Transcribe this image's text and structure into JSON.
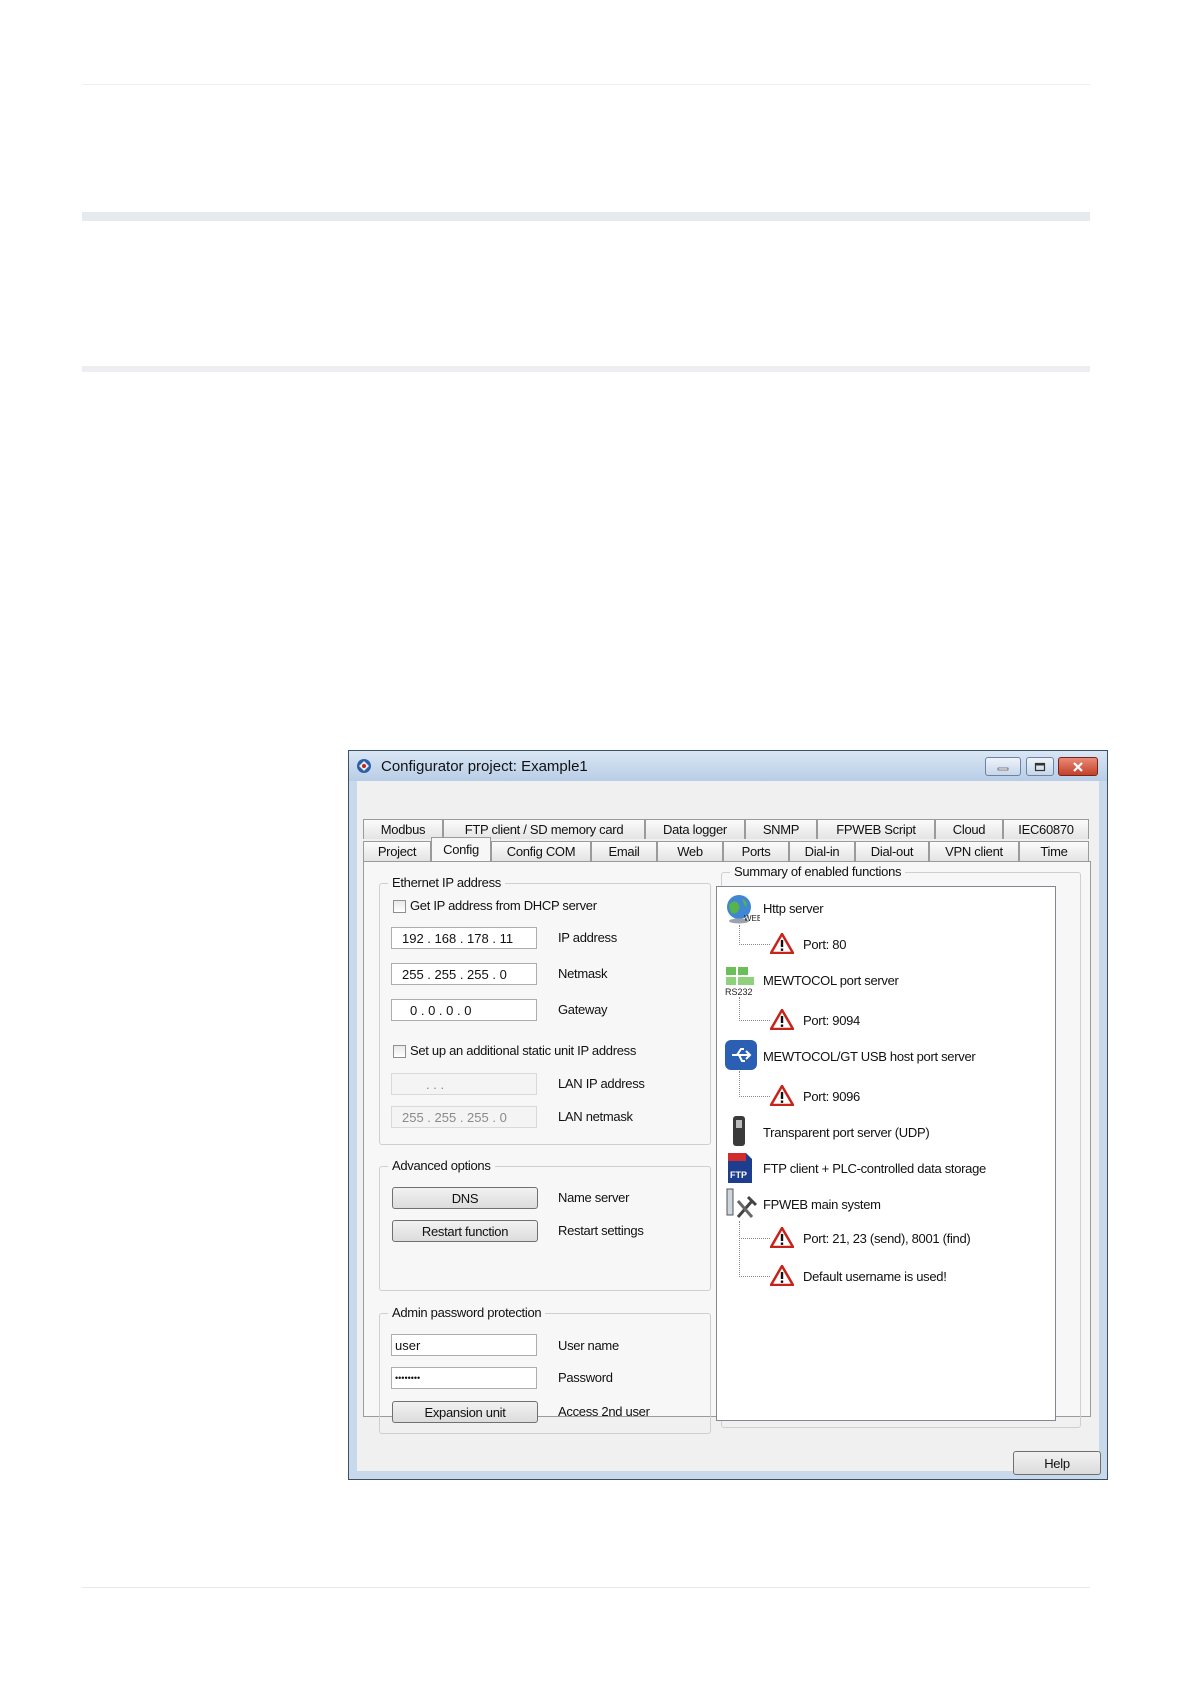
{
  "window": {
    "title": "Configurator project: Example1",
    "tabs_row1": [
      "Modbus",
      "FTP client / SD memory card",
      "Data logger",
      "SNMP",
      "FPWEB Script",
      "Cloud",
      "IEC60870"
    ],
    "tabs_row2": [
      "Project",
      "Config",
      "Config COM",
      "Email",
      "Web",
      "Ports",
      "Dial-in",
      "Dial-out",
      "VPN client",
      "Time"
    ],
    "active_tab": "Config"
  },
  "ethernet": {
    "title": "Ethernet IP address",
    "dhcp_label": "Get IP address from DHCP server",
    "dhcp_checked": false,
    "ip_value": "192 . 168 . 178 .  11",
    "ip_label": "IP address",
    "netmask_value": "255 . 255 . 255 .   0",
    "netmask_label": "Netmask",
    "gateway_value": "0   .   0   .   0   .   0",
    "gateway_label": "Gateway",
    "static_label": "Set up an additional static unit IP address",
    "static_checked": false,
    "lan_ip_value": ".      .      .",
    "lan_ip_label": "LAN IP address",
    "lan_mask_value": "255 . 255 . 255 .   0",
    "lan_mask_label": "LAN netmask"
  },
  "advanced": {
    "title": "Advanced options",
    "dns_button": "DNS",
    "dns_label": "Name server",
    "restart_button": "Restart function",
    "restart_label": "Restart settings"
  },
  "admin": {
    "title": "Admin password protection",
    "username_value": "user",
    "username_label": "User name",
    "password_value": "••••••••",
    "password_label": "Password",
    "expansion_button": "Expansion unit",
    "expansion_label": "Access 2nd user"
  },
  "summary": {
    "title": "Summary of enabled functions",
    "http": "Http server",
    "http_port": "Port: 80",
    "mewtocol": "MEWTOCOL port server",
    "mewtocol_port": "Port: 9094",
    "usb": "MEWTOCOL/GT USB host port server",
    "usb_port": "Port: 9096",
    "udp": "Transparent port server (UDP)",
    "ftp": "FTP client + PLC-controlled data storage",
    "fpweb": "FPWEB main system",
    "fpweb_port": "Port: 21, 23 (send), 8001 (find)",
    "fpweb_warning": "Default username is used!",
    "icon_web_text": "WEB",
    "icon_rs232_text": "RS232",
    "icon_ftp_text": "FTP"
  },
  "help_button": "Help",
  "colors": {
    "warning_red": "#c8231b",
    "titlebar": "#c4d6ec",
    "close_button": "#c8472f"
  }
}
